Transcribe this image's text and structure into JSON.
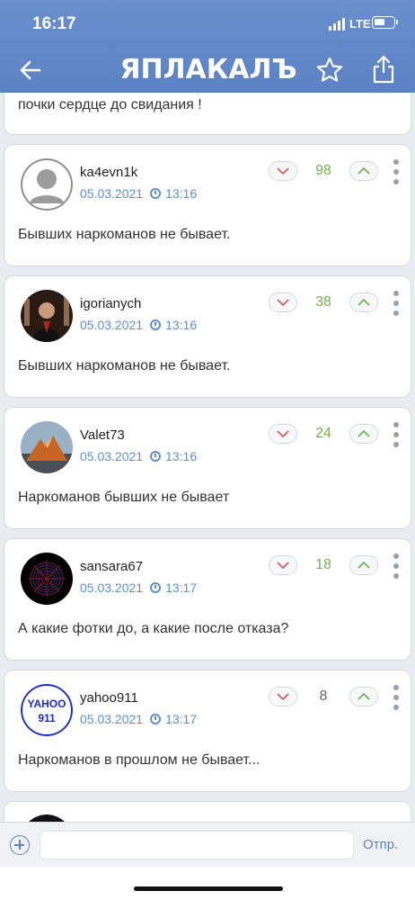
{
  "status_bar": {
    "time": "16:17",
    "network": "LTE"
  },
  "header": {
    "logo_text": "ЯПЛАКАЛЪ",
    "back_icon": "back-arrow-icon",
    "star_icon": "star-icon",
    "share_icon": "share-icon"
  },
  "partial_comment": {
    "text": "почки сердце до свидания !"
  },
  "comments": [
    {
      "username": "ka4evn1k",
      "date": "05.03.2021",
      "time": "13:16",
      "score": "98",
      "text": "Бывших наркоманов не бывает.",
      "avatar": "default-avatar"
    },
    {
      "username": "igorianych",
      "date": "05.03.2021",
      "time": "13:16",
      "score": "38",
      "text": "Бывших наркоманов не бывает.",
      "avatar": "photo-avatar"
    },
    {
      "username": "Valet73",
      "date": "05.03.2021",
      "time": "13:16",
      "score": "24",
      "text": "Наркоманов бывших не бывает",
      "avatar": "mountain-avatar"
    },
    {
      "username": "sansara67",
      "date": "05.03.2021",
      "time": "13:17",
      "score": "18",
      "text": "А какие фотки до, а какие после отказа?",
      "avatar": "web-avatar"
    },
    {
      "username": "yahoo911",
      "date": "05.03.2021",
      "time": "13:17",
      "score": "8",
      "text": "Наркоманов в прошлом не бывает...",
      "avatar": "yahoo-avatar",
      "avatar_text": [
        "YAHOO",
        "911"
      ]
    }
  ],
  "input_bar": {
    "placeholder": "",
    "send_label": "Отпр."
  },
  "colors": {
    "header": "#5b82c4",
    "score_positive": "#74b24e",
    "link": "#5d8fd0"
  }
}
